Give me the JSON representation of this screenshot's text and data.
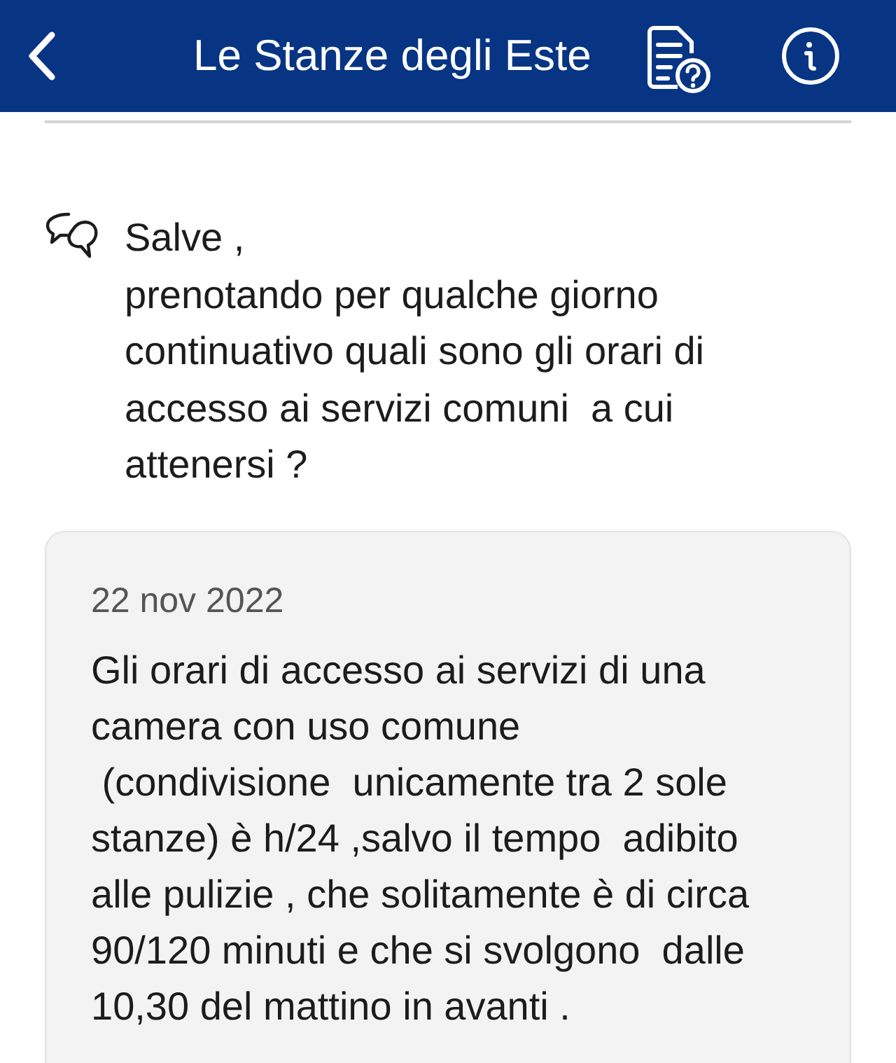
{
  "header": {
    "title": "Le Stanze degli Este"
  },
  "question": {
    "text": "Salve ,\nprenotando per qualche giorno\ncontinuativo quali sono gli orari di\naccesso ai servizi comuni  a cui\nattenersi ?"
  },
  "answer": {
    "date": "22 nov 2022",
    "text": "Gli orari di accesso ai servizi di una\ncamera con uso comune\n (condivisione  unicamente tra 2 sole\nstanze) è h/24 ,salvo il tempo  adibito\nalle pulizie , che solitamente è di circa\n90/120 minuti e che si svolgono  dalle\n10,30 del mattino in avanti ."
  }
}
